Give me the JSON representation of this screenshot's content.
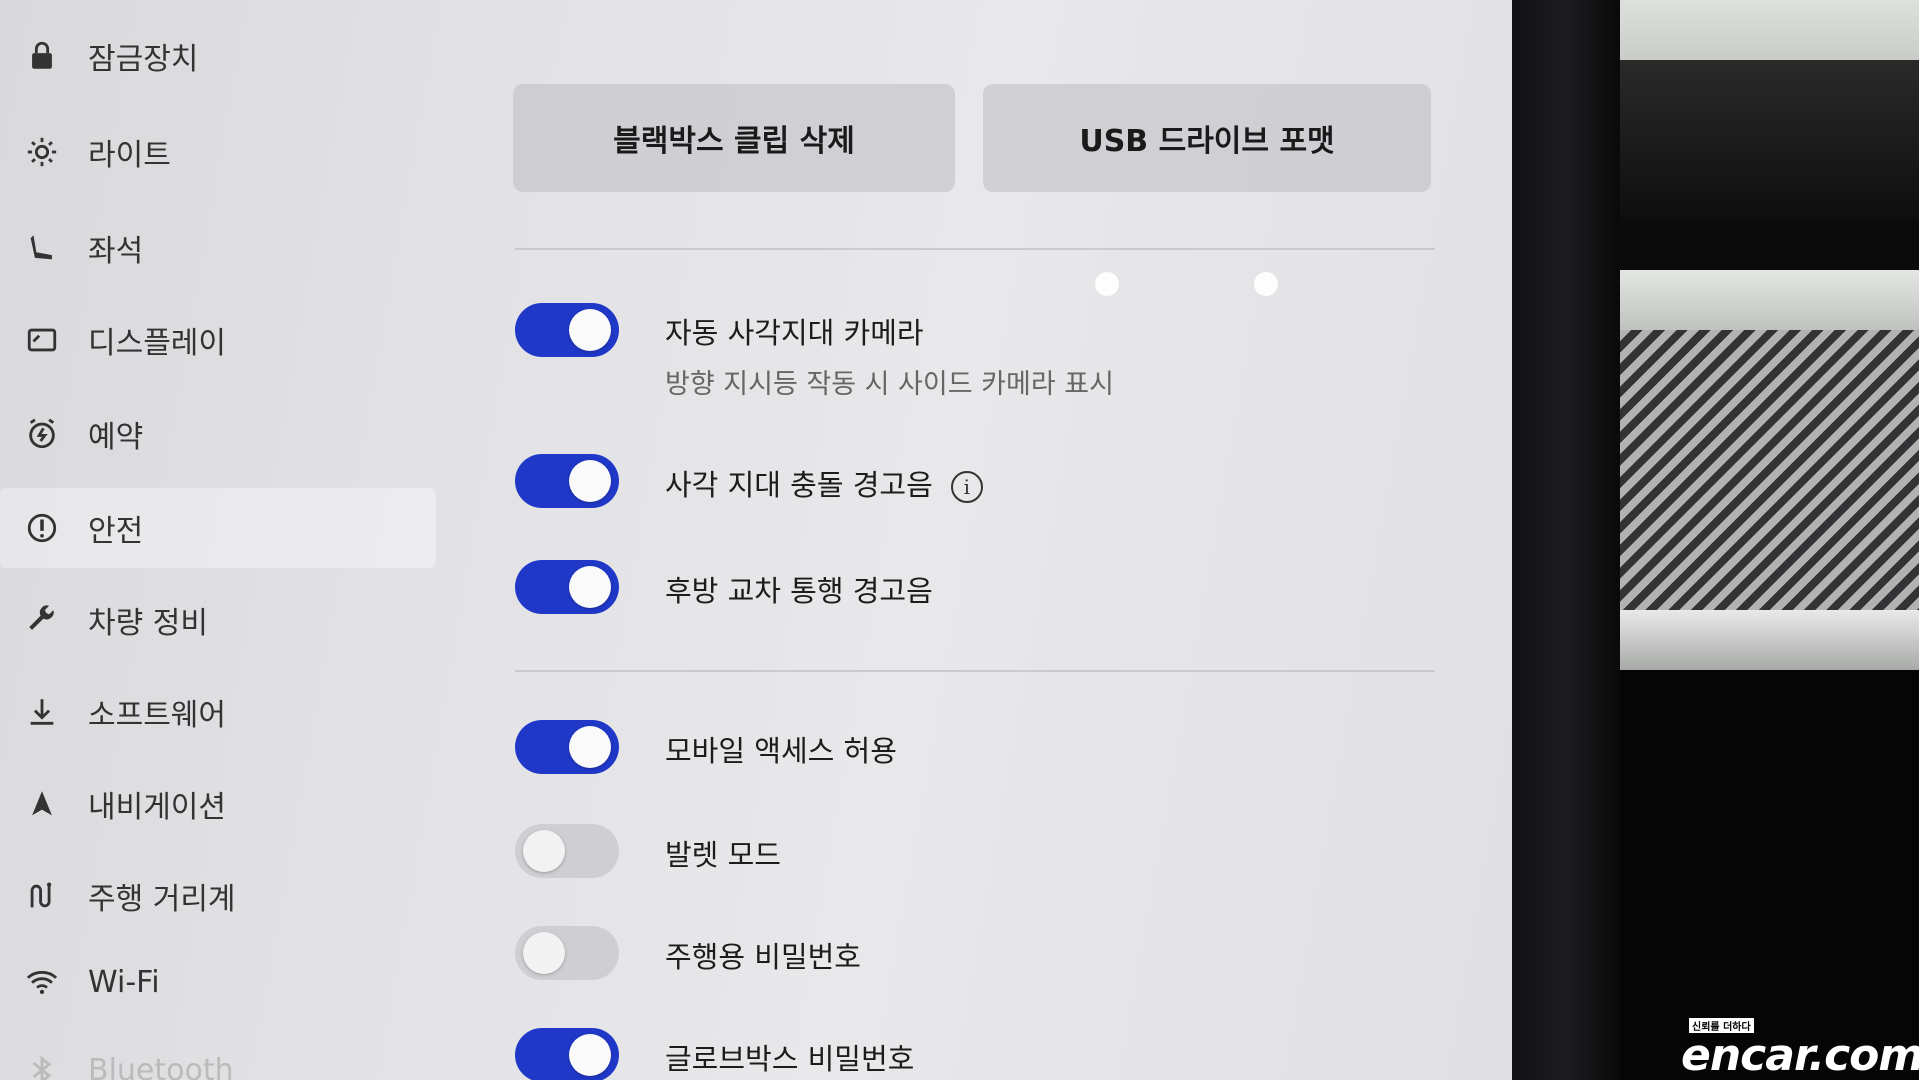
{
  "sidebar": {
    "items": [
      {
        "label": "잠금장치",
        "icon": "lock-icon"
      },
      {
        "label": "라이트",
        "icon": "light-icon"
      },
      {
        "label": "좌석",
        "icon": "seat-icon"
      },
      {
        "label": "디스플레이",
        "icon": "display-icon"
      },
      {
        "label": "예약",
        "icon": "schedule-icon"
      },
      {
        "label": "안전",
        "icon": "safety-icon",
        "active": true
      },
      {
        "label": "차량 정비",
        "icon": "wrench-icon"
      },
      {
        "label": "소프트웨어",
        "icon": "download-icon"
      },
      {
        "label": "내비게이션",
        "icon": "navigation-icon"
      },
      {
        "label": "주행 거리계",
        "icon": "trips-icon"
      },
      {
        "label": "Wi-Fi",
        "icon": "wifi-icon"
      },
      {
        "label": "Bluetooth",
        "icon": "bluetooth-icon"
      }
    ]
  },
  "buttons": {
    "delete_clips": "블랙박스 클립 삭제",
    "format_usb": "USB 드라이브 포맷"
  },
  "settings": {
    "blind_spot_camera": {
      "label": "자동 사각지대 카메라",
      "sub": "방향 지시등 작동 시 사이드 카메라 표시",
      "on": true
    },
    "blind_spot_chime": {
      "label": "사각 지대 충돌 경고음",
      "on": true,
      "info_icon": "info-icon"
    },
    "rear_cross_traffic": {
      "label": "후방 교차 통행 경고음",
      "on": true
    },
    "mobile_access": {
      "label": "모바일 액세스 허용",
      "on": true
    },
    "valet_mode": {
      "label": "발렛 모드",
      "on": false
    },
    "pin_to_drive": {
      "label": "주행용 비밀번호",
      "on": false
    },
    "glovebox_pin": {
      "label": "글로브박스 비밀번호",
      "on": true
    }
  },
  "watermark": {
    "tagline": "신뢰를 더하다",
    "brand": "encar.com"
  },
  "colors": {
    "toggle_on": "#2038c8",
    "toggle_off": "#cfcfd3",
    "screen_bg": "#e4e4e7"
  }
}
